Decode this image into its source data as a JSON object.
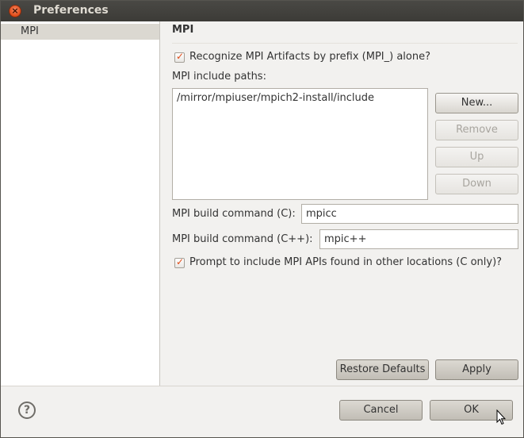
{
  "window": {
    "title": "Preferences"
  },
  "sidebar": {
    "items": [
      {
        "label": "MPI"
      }
    ]
  },
  "page": {
    "title": "MPI",
    "recognize_checkbox": {
      "label": "Recognize MPI Artifacts by prefix (MPI_) alone?",
      "checked": true
    },
    "include_paths_label": "MPI include paths:",
    "include_paths": [
      "/mirror/mpiuser/mpich2-install/include"
    ],
    "buttons": {
      "new": "New...",
      "remove": "Remove",
      "up": "Up",
      "down": "Down"
    },
    "build_c": {
      "label": "MPI build command (C):",
      "value": "mpicc"
    },
    "build_cpp": {
      "label": "MPI build command (C++):",
      "value": "mpic++"
    },
    "prompt_checkbox": {
      "label": "Prompt to include MPI APIs found in other locations (C only)?",
      "checked": true
    },
    "restore_defaults": "Restore Defaults",
    "apply": "Apply"
  },
  "footer": {
    "help_icon": "?",
    "cancel": "Cancel",
    "ok": "OK"
  },
  "colors": {
    "accent": "#e14b17",
    "titlebar": "#3c3b37",
    "background": "#f2f1ef"
  },
  "icons": {
    "close": "close-icon",
    "help": "help-icon",
    "check": "checkmark-icon"
  }
}
